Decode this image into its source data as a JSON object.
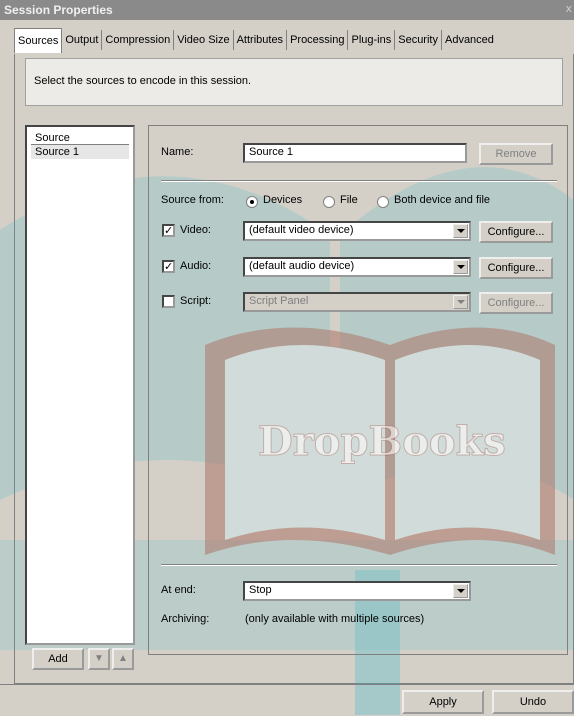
{
  "window": {
    "title": "Session Properties",
    "close_glyph": "x"
  },
  "tabs": [
    {
      "label": "Sources",
      "active": true
    },
    {
      "label": "Output"
    },
    {
      "label": "Compression"
    },
    {
      "label": "Video Size"
    },
    {
      "label": "Attributes"
    },
    {
      "label": "Processing"
    },
    {
      "label": "Plug-ins"
    },
    {
      "label": "Security"
    },
    {
      "label": "Advanced"
    }
  ],
  "hint": "Select the sources to encode in this session.",
  "sources": {
    "header": "Source",
    "items": [
      "Source 1"
    ]
  },
  "name": {
    "label": "Name:",
    "value": "Source 1",
    "remove_button": "Remove"
  },
  "source_from": {
    "label": "Source from:",
    "options": [
      {
        "label": "Devices",
        "selected": true
      },
      {
        "label": "File",
        "selected": false
      },
      {
        "label": "Both device and file",
        "selected": false
      }
    ]
  },
  "video": {
    "label": "Video:",
    "checked": true,
    "value": "(default video device)",
    "button": "Configure..."
  },
  "audio": {
    "label": "Audio:",
    "checked": true,
    "value": "(default audio device)",
    "button": "Configure..."
  },
  "script": {
    "label": "Script:",
    "checked": false,
    "value": "Script Panel",
    "button": "Configure..."
  },
  "at_end": {
    "label": "At end:",
    "value": "Stop"
  },
  "archiving": {
    "label": "Archiving:",
    "value": "(only available with multiple sources)"
  },
  "list_buttons": {
    "add": "Add",
    "down_glyph": "▼",
    "up_glyph": "▲"
  },
  "footer": {
    "apply": "Apply",
    "undo": "Undo"
  },
  "watermark": {
    "text": "DropBooks"
  },
  "colors": {
    "watermark_teal": "#38b6c8",
    "watermark_brown": "#8b2a1a"
  }
}
